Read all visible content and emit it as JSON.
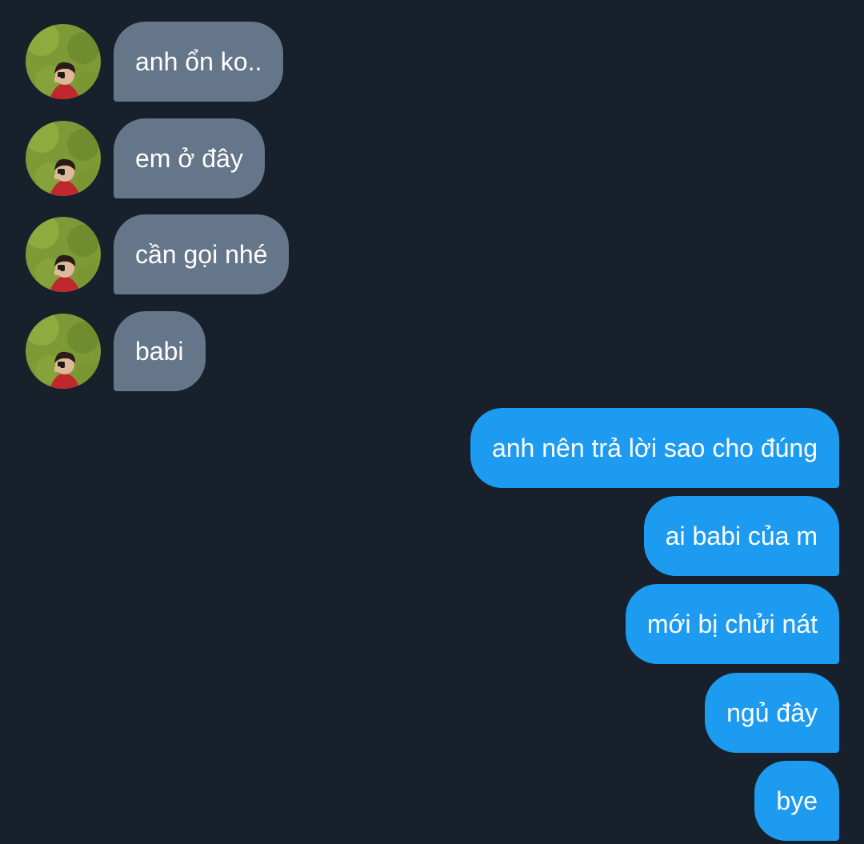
{
  "conversation": {
    "incoming": [
      {
        "text": "anh ổn ko..",
        "avatar": "user-avatar-photo"
      },
      {
        "text": "em ở đây",
        "avatar": "user-avatar-photo"
      },
      {
        "text": "cần gọi nhé",
        "avatar": "user-avatar-photo"
      },
      {
        "text": "babi",
        "avatar": "user-avatar-photo"
      }
    ],
    "outgoing": [
      {
        "text": "anh nên trả lời sao cho đúng"
      },
      {
        "text": "ai babi của m"
      },
      {
        "text": "mới bị chửi nát "
      },
      {
        "text": "ngủ đây"
      },
      {
        "text": "bye"
      }
    ]
  },
  "colors": {
    "background": "#17202b",
    "incoming_bubble": "#66768a",
    "outgoing_bubble": "#1d9bf0",
    "text": "#ffffff"
  }
}
